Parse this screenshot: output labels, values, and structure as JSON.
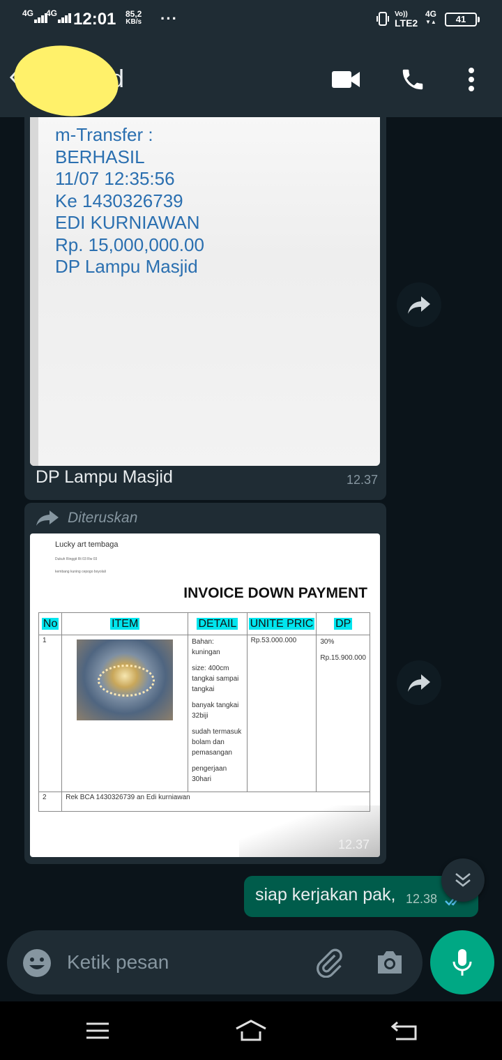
{
  "status_bar": {
    "network1": "4G",
    "network2": "4G",
    "time": "12:01",
    "speed_value": "85,2",
    "speed_unit": "KB/s",
    "dots": "···",
    "volte_top": "Vo))",
    "volte_bottom": "LTE2",
    "network3": "4G",
    "battery": "41"
  },
  "header": {
    "title": "asjid",
    "back_icon": "back-arrow-icon",
    "video_icon": "video-call-icon",
    "call_icon": "phone-icon",
    "menu_icon": "more-vert-icon"
  },
  "messages": [
    {
      "type": "image",
      "direction": "incoming",
      "image_text_lines": [
        "m-Transfer :",
        "BERHASIL",
        "11/07 12:35:56",
        "Ke 1430326739",
        "EDI KURNIAWAN",
        "Rp. 15,000,000.00",
        "DP Lampu Masjid"
      ],
      "caption": "DP Lampu Masjid",
      "time": "12.37"
    },
    {
      "type": "image",
      "direction": "incoming",
      "forwarded_label": "Diteruskan",
      "time": "12.37",
      "invoice": {
        "brand": "Lucky art tembaga",
        "address1": "Dukuh Ringgit Rt 03 Rw 03",
        "address2": "kembang kuning cepogo boyolali",
        "title": "INVOICE DOWN PAYMENT",
        "headers": [
          "No",
          "ITEM",
          "DETAIL",
          "UNITE PRIC",
          "DP"
        ],
        "row1": {
          "no": "1",
          "details": [
            "Bahan: kuningan",
            "size: 400cm tangkai sampai tangkai",
            "banyak tangkai 32biji",
            "sudah termasuk bolam dan pemasangan",
            "pengerjaan 30hari"
          ],
          "unit_price": "Rp.53.000.000",
          "dp_percent": "30%",
          "dp_amount": "Rp.15.900.000"
        },
        "row2": {
          "no": "2",
          "text": "Rek BCA 1430326739 an Edi kurniawan"
        }
      }
    },
    {
      "type": "text",
      "direction": "outgoing",
      "text": "siap kerjakan pak,",
      "time": "12.38",
      "status": "read"
    }
  ],
  "input": {
    "placeholder": "Ketik pesan"
  },
  "colors": {
    "header_bg": "#1f2c34",
    "chat_bg": "#0b141a",
    "outgoing_bubble": "#005c4b",
    "accent": "#00a884",
    "read_tick": "#53bdeb"
  }
}
